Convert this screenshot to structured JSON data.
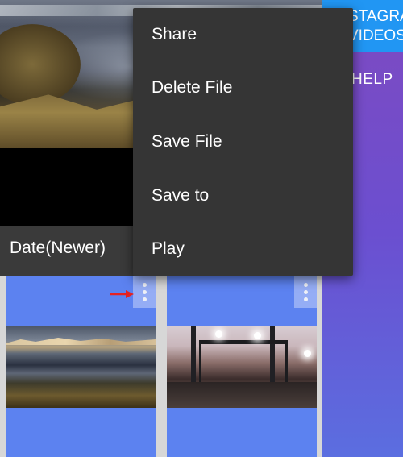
{
  "header": {
    "instagram_button_label": "STAGRA\nVIDEOS",
    "help_label": "HELP"
  },
  "sort": {
    "label": "Date(Newer)"
  },
  "context_menu": {
    "items": [
      {
        "label": "Share"
      },
      {
        "label": "Delete File"
      },
      {
        "label": "Save File"
      },
      {
        "label": "Save to"
      },
      {
        "label": "Play"
      }
    ]
  },
  "grid": {
    "items": [
      {
        "thumbnail": "lake-mountain-landscape",
        "menu_icon": "more-vert-icon"
      },
      {
        "thumbnail": "concert-stage-crowd",
        "menu_icon": "more-vert-icon"
      }
    ]
  },
  "annotation": {
    "arrow_color": "#e52222"
  },
  "colors": {
    "menu_bg": "#353535",
    "card_bg": "#5c82f0",
    "instagram_button": "#2196f3",
    "right_panel": "#6b4fd0"
  }
}
